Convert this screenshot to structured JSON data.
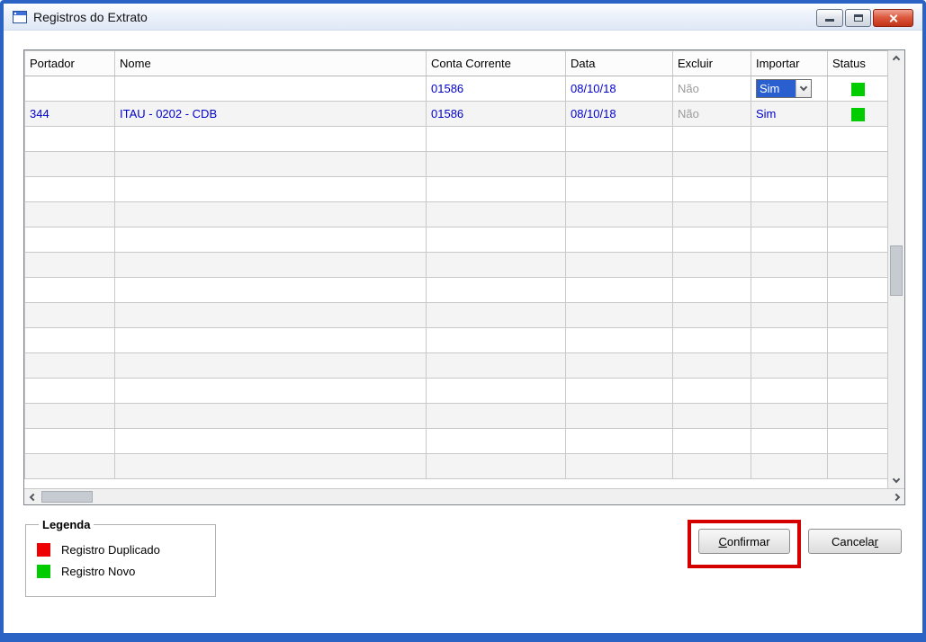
{
  "window": {
    "title": "Registros do Extrato"
  },
  "grid": {
    "columns": [
      "Portador",
      "Nome",
      "Conta Corrente",
      "Data",
      "Excluir",
      "Importar",
      "Status"
    ],
    "rows": [
      {
        "portador": "",
        "nome": "",
        "conta_corrente": "01586",
        "data": "08/10/18",
        "excluir": "Não",
        "importar": "Sim",
        "status": "novo"
      },
      {
        "portador": "344",
        "nome": "ITAU - 0202 - CDB",
        "conta_corrente": "01586",
        "data": "08/10/18",
        "excluir": "Não",
        "importar": "Sim",
        "status": "novo"
      }
    ],
    "empty_rows": 14
  },
  "legend": {
    "title": "Legenda",
    "items": [
      {
        "label": "Registro Duplicado",
        "color": "#ee0000"
      },
      {
        "label": "Registro Novo",
        "color": "#00cc00"
      }
    ]
  },
  "buttons": {
    "confirm": {
      "mnemonic": "C",
      "rest": "onfirmar"
    },
    "cancel": {
      "pre": "Cancela",
      "mnemonic": "r",
      "post": ""
    }
  },
  "colors": {
    "window_border": "#2b63c5",
    "status_new": "#00cc00",
    "status_duplicate": "#ee0000",
    "grid_text": "#0000cc",
    "muted_text": "#9b9b9b",
    "combo_selection": "#2a5fd0",
    "annotation": "#d40000"
  }
}
